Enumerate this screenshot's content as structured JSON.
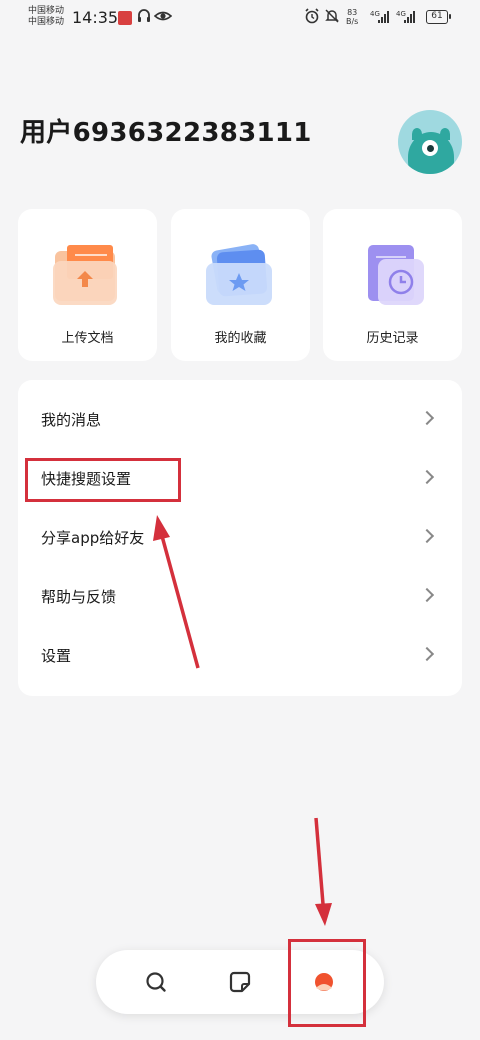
{
  "status_bar": {
    "carrier_1": "中国移动",
    "carrier_2": "中国移动",
    "time": "14:35",
    "speed_value": "83",
    "speed_unit": "B/s",
    "network_1": "4G",
    "network_2": "4G",
    "battery": "61"
  },
  "user": {
    "name": "用户6936322383111"
  },
  "quick_actions": [
    {
      "label": "上传文档",
      "icon": "upload-folder-icon"
    },
    {
      "label": "我的收藏",
      "icon": "favorites-star-icon"
    },
    {
      "label": "历史记录",
      "icon": "history-clock-icon"
    }
  ],
  "menu": {
    "items": [
      {
        "label": "我的消息"
      },
      {
        "label": "快捷搜题设置"
      },
      {
        "label": "分享app给好友"
      },
      {
        "label": "帮助与反馈"
      },
      {
        "label": "设置"
      }
    ]
  },
  "bottom_nav": {
    "items": [
      {
        "icon": "search-icon",
        "active": false
      },
      {
        "icon": "notes-icon",
        "active": false
      },
      {
        "icon": "profile-icon",
        "active": true
      }
    ]
  },
  "colors": {
    "annotation_red": "#d4303c",
    "active_tab": "#f0522e",
    "background": "#f5f5f6"
  }
}
